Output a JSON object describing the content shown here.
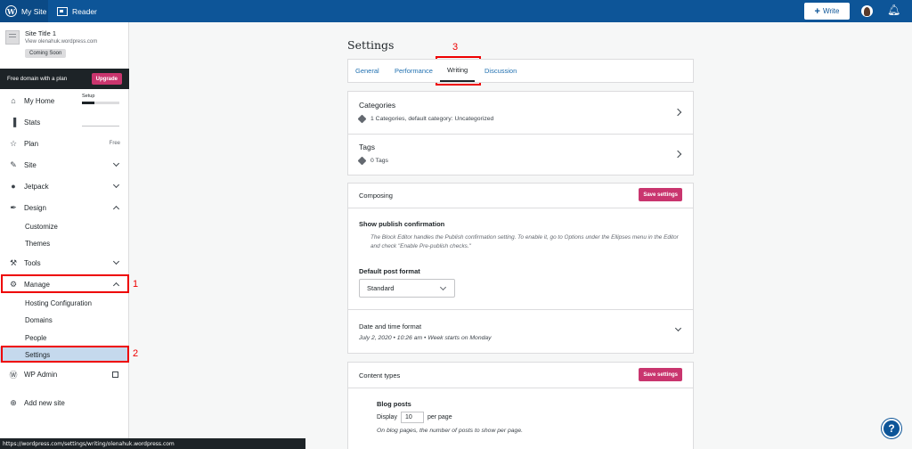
{
  "topbar": {
    "my_site": "My Site",
    "reader": "Reader",
    "write": "Write"
  },
  "sidebar": {
    "site_title": "Site Title 1",
    "site_url": "View olenahuk.wordpress.com",
    "coming_soon": "Coming Soon",
    "domain_banner": "Free domain with a plan",
    "upgrade": "Upgrade",
    "setup_label": "Setup",
    "setup_progress": 0.33,
    "items": [
      {
        "label": "My Home",
        "icon": "home-icon"
      },
      {
        "label": "Stats",
        "icon": "stats-icon"
      },
      {
        "label": "Plan",
        "icon": "star-icon",
        "badge": "Free"
      },
      {
        "label": "Site",
        "icon": "pencil-icon"
      },
      {
        "label": "Jetpack",
        "icon": "jetpack-icon"
      },
      {
        "label": "Design",
        "icon": "brush-icon"
      },
      {
        "label": "Tools",
        "icon": "wrench-icon"
      },
      {
        "label": "Manage",
        "icon": "gear-icon"
      },
      {
        "label": "WP Admin",
        "icon": "wordpress-icon"
      },
      {
        "label": "Add new site",
        "icon": "add-icon"
      }
    ],
    "design_sub": [
      "Customize",
      "Themes"
    ],
    "manage_sub": [
      "Hosting Configuration",
      "Domains",
      "People",
      "Settings"
    ]
  },
  "annotations": [
    "1",
    "2",
    "3"
  ],
  "settings": {
    "title": "Settings",
    "tabs": [
      "General",
      "Performance",
      "Writing",
      "Discussion"
    ],
    "active_tab": "Writing",
    "categories": {
      "title": "Categories",
      "sub": "1 Categories, default category: Uncategorized"
    },
    "tags": {
      "title": "Tags",
      "sub": "0 Tags"
    },
    "composing": {
      "header": "Composing",
      "save": "Save settings",
      "publish_confirm_label": "Show publish confirmation",
      "publish_confirm_note": "The Block Editor handles the Publish confirmation setting. To enable it, go to Options under the Ellipses menu in the Editor and check \"Enable Pre-publish checks.\"",
      "post_format_label": "Default post format",
      "post_format_value": "Standard",
      "date_label": "Date and time format",
      "date_value": "July 2, 2020 • 10:26 am • Week starts on Monday"
    },
    "content_types": {
      "header": "Content types",
      "save": "Save settings",
      "blog_posts_label": "Blog posts",
      "display_prefix": "Display",
      "display_value": "10",
      "display_suffix": "per page",
      "note": "On blog pages, the number of posts to show per page."
    }
  },
  "status_url": "https://wordpress.com/settings/writing/olenahuk.wordpress.com",
  "colors": {
    "topbar": "#0d5598",
    "accent_pink": "#c9356e",
    "highlight_red": "#ee0000",
    "active_sidebar": "#c5d9ed"
  }
}
